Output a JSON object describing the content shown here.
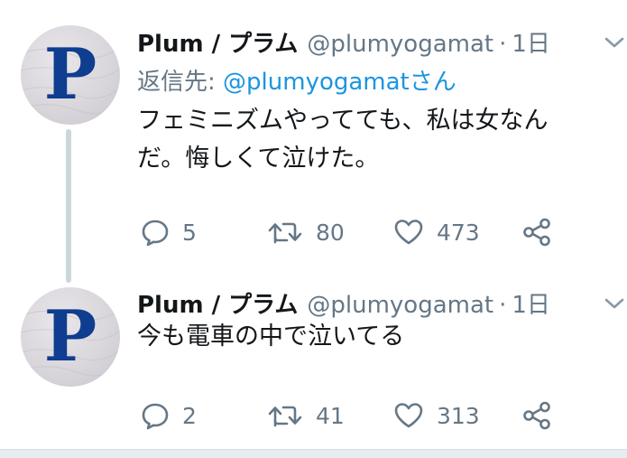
{
  "tweets": [
    {
      "avatar_letter": "P",
      "display_name": "Plum / プラム",
      "handle": "@plumyogamat",
      "separator": "·",
      "time": "1日",
      "reply_prefix": "返信先: ",
      "reply_to": "@plumyogamatさん",
      "text_line1": "フェミニズムやってても、私は女なん",
      "text_line2": "だ。悔しくて泣けた。",
      "replies": "5",
      "retweets": "80",
      "likes": "473",
      "icons": [
        "comment-icon",
        "retweet-icon",
        "heart-icon",
        "share-icon",
        "chevron-down-icon"
      ]
    },
    {
      "avatar_letter": "P",
      "display_name": "Plum / プラム",
      "handle": "@plumyogamat",
      "separator": "·",
      "time": "1日",
      "text_line1": "今も電車の中で泣いてる",
      "replies": "2",
      "retweets": "41",
      "likes": "313",
      "icons": [
        "comment-icon",
        "retweet-icon",
        "heart-icon",
        "share-icon",
        "chevron-down-icon"
      ]
    }
  ],
  "colors": {
    "text": "#14171a",
    "secondary": "#657786",
    "link": "#1b95e0",
    "thread_line": "#ccd6dd",
    "avatar_letter": "#0f3d8f"
  }
}
